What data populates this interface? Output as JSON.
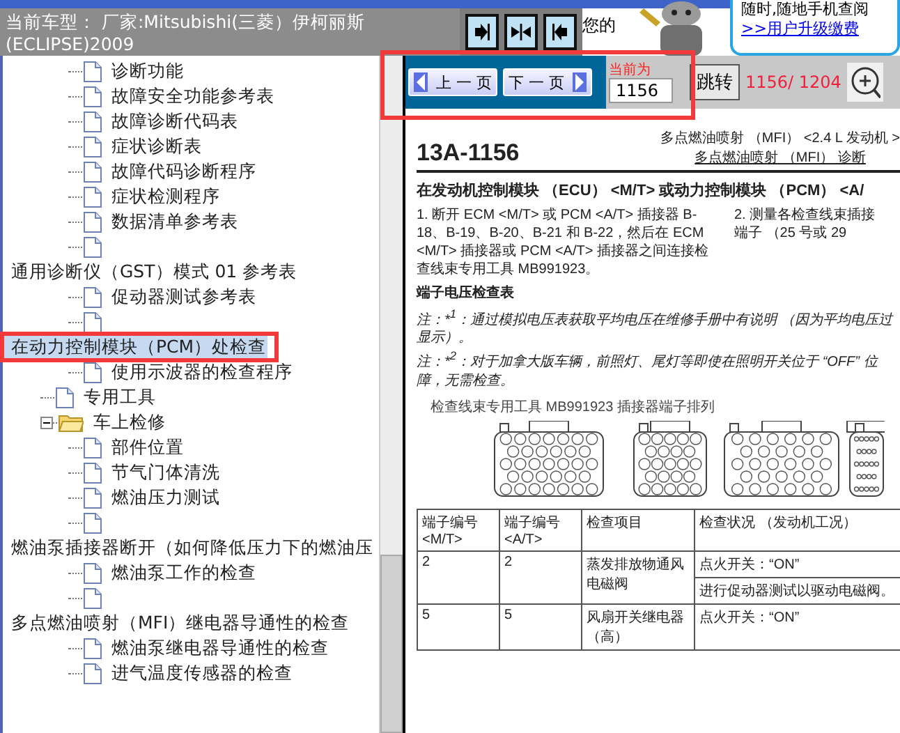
{
  "header": {
    "car_model": "当前车型： 厂家:Mitsubishi(三菱）伊柯丽斯(ECLIPSE)2009",
    "notice": "您的",
    "ad_line": "随时,随地手机查阅",
    "ad_link": ">>用户升级缴费"
  },
  "tree": [
    {
      "kind": "branch",
      "children": [
        {
          "kind": "page",
          "label": "诊断功能",
          "selected": false
        },
        {
          "kind": "page",
          "label": "故障安全功能参考表",
          "selected": false
        },
        {
          "kind": "page",
          "label": "故障诊断代码表",
          "selected": false
        },
        {
          "kind": "page",
          "label": "症状诊断表",
          "selected": false
        },
        {
          "kind": "page",
          "label": "故障代码诊断程序",
          "selected": false
        },
        {
          "kind": "page",
          "label": "症状检测程序",
          "selected": false
        },
        {
          "kind": "page",
          "label": "数据清单参考表",
          "selected": false
        },
        {
          "kind": "blank",
          "selected": false
        },
        {
          "kind": "heading",
          "label": "通用诊断仪（GST）模式 01 参考表",
          "selected": false
        },
        {
          "kind": "page",
          "label": "促动器测试参考表",
          "selected": false
        },
        {
          "kind": "blank",
          "selected": false
        },
        {
          "kind": "heading",
          "label": "在动力控制模块（PCM）处检查",
          "selected": true
        },
        {
          "kind": "page",
          "label": "使用示波器的检查程序",
          "selected": false
        }
      ]
    },
    {
      "kind": "page",
      "label": "专用工具",
      "selected": false
    },
    {
      "kind": "folder",
      "label": "车上检修",
      "expanded": true,
      "selected": false,
      "children": [
        {
          "kind": "page",
          "label": "部件位置",
          "selected": false
        },
        {
          "kind": "page",
          "label": "节气门体清洗",
          "selected": false
        },
        {
          "kind": "page",
          "label": "燃油压力测试",
          "selected": false
        },
        {
          "kind": "blank",
          "selected": false
        },
        {
          "kind": "heading",
          "label": "燃油泵插接器断开（如何降低压力下的燃油压",
          "selected": false
        },
        {
          "kind": "page",
          "label": "燃油泵工作的检查",
          "selected": false
        },
        {
          "kind": "blank",
          "selected": false
        },
        {
          "kind": "heading",
          "label": "多点燃油喷射（MFI）继电器导通性的检查",
          "selected": false
        },
        {
          "kind": "page",
          "label": "燃油泵继电器导通性的检查",
          "selected": false
        },
        {
          "kind": "page",
          "label": "进气温度传感器的检查",
          "selected": false
        }
      ]
    }
  ],
  "pager": {
    "prev": "上 一 页",
    "next": "下 一 页",
    "current_label": "当前为",
    "current_page": "1156",
    "go": "跳转",
    "position": "1156/ 1204"
  },
  "document": {
    "page_id": "13A-1156",
    "section": "多点燃油喷射 （MFI） <2.4 L 发动机 >",
    "subsection": "多点燃油喷射 （MFI） 诊断",
    "heading": "在发动机控制模块 （ECU） <M/T> 或动力控制模块 （PCM） <A/",
    "steps": [
      {
        "lines": [
          "1. 断开 ECM <M/T> 或 PCM <A/T> 插接器 B-18、B-19、B-20、B-21 和 B-22，然后在 ECM <M/T> 插接器或 PCM <A/T> 插接器之间连接检查线束专用工具 MB991923。"
        ]
      },
      {
        "lines": [
          "2. 测量各检查线束插接",
          "端子 （25 号或 29"
        ]
      }
    ],
    "table_title": "端子电压检查表",
    "notes": [
      {
        "lines": [
          "注：*$^{1}$：通过模拟电压表获取平均电压在维修手册中有说明 （因为平均电压过",
          "显示）。"
        ]
      },
      {
        "lines": [
          "注：*$^{2}$：对于加拿大版车辆，前照灯、尾灯等即使在照明开关位于 “OFF” 位",
          "障，无需检查。"
        ]
      }
    ],
    "figure_caption": "检查线束专用工具 MB991923 插接器端子排列",
    "table": {
      "columns": [
        "端子编号 <M/T>",
        "端子编号 <A/T>",
        "检查项目",
        "检查状况 （发动机工况）"
      ],
      "rows": [
        {
          "cells": [
            "2",
            "2",
            "蒸发排放物通风电磁阀"
          ],
          "conditions": [
            "点火开关：“ON”",
            "进行促动器测试以驱动电磁阀。"
          ]
        },
        {
          "cells": [
            "5",
            "5",
            "风扇开关继电器（高）"
          ],
          "conditions": [
            "点火开关：“ON”"
          ]
        }
      ]
    }
  }
}
